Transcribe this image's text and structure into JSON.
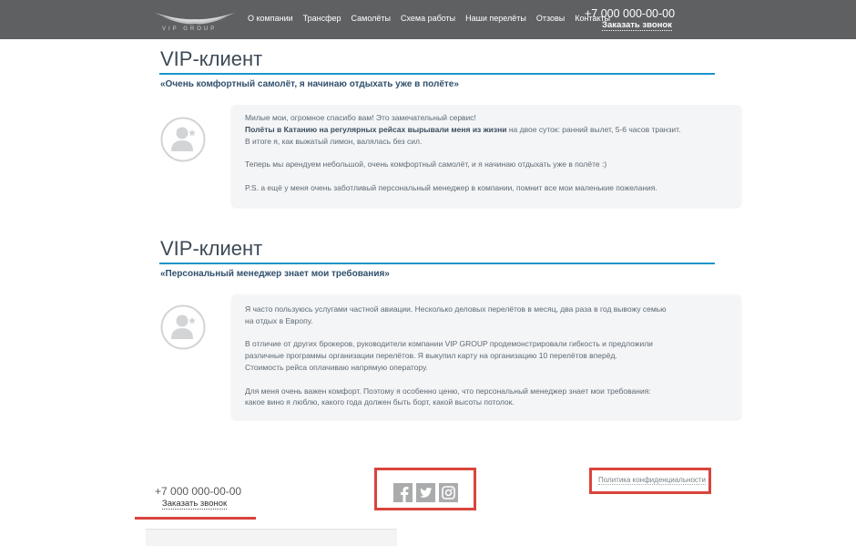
{
  "header": {
    "logo_text": "VIP GROUP",
    "nav": [
      "О компании",
      "Трансфер",
      "Самолёты",
      "Схема работы",
      "Наши перелёты",
      "Отзовы",
      "Контакты"
    ],
    "phone": "+7 000 000-00-00",
    "callback": "Заказать звонок"
  },
  "reviews": [
    {
      "title": "VIP-клиент",
      "subtitle": "«Очень комфортный самолёт, я начинаю отдыхать уже в полёте»",
      "l1": "Милые мои, огромное спасибо вам! Это замечательный сервис!",
      "l2_bold": "Полёты в Катанию на регулярных рейсах вырывали меня из жизни",
      "l2_rest": " на двое суток: ранний вылет, 5-6 часов транзит.",
      "l3": "В итоге я, как выжатый лимон, валялась без сил.",
      "l4": "Теперь мы арендуем небольшой, очень комфортный самолёт, и я начинаю отдыхать уже в полёте :)",
      "l5": "P.S. а ещё у меня очень заботливый персональный менеджер в компании, помнит все мои маленькие пожелания."
    },
    {
      "title": "VIP-клиент",
      "subtitle": "«Персональный менеджер знает мои требования»",
      "l1": "Я часто пользуюсь услугами частной авиации. Несколько деловых перелётов в месяц, два раза в год вывожу семью",
      "l2": "на отдых в Европу.",
      "l3": "В отличие от других брокеров, руководители компании VIP GROUP продемонстрировали гибкость и предложили",
      "l4": "различные программы организации перелётов. Я выкупил карту на организацию 10 перелётов вперёд.",
      "l5": "Стоимость рейса оплачиваю напрямую оператору.",
      "l6": "Для меня очень важен комфорт. Поэтому я особенно ценю, что персональный менеджер знает мои требования:",
      "l7": "какое вино я люблю, какого года должен быть борт, какой высоты потолок."
    }
  ],
  "footer": {
    "phone": "+7 000 000-00-00",
    "callback": "Заказать звонок",
    "social": [
      "facebook-icon",
      "twitter-icon",
      "instagram-icon"
    ],
    "privacy": "Политика конфиденциальности"
  },
  "colors": {
    "header_bg": "#5f6062",
    "accent_blue": "#1b95c9",
    "highlight_red": "#d9443c"
  }
}
